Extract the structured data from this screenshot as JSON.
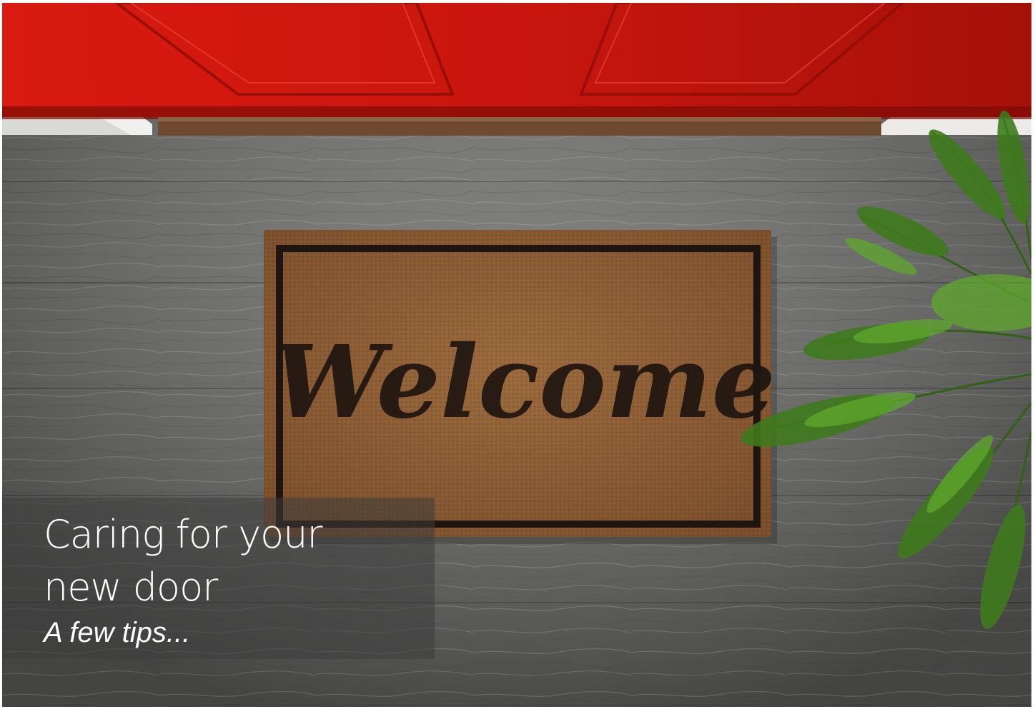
{
  "scene": {
    "mat_text": "Welcome",
    "colors": {
      "door": "#c9160e",
      "floor": "#6a6a68",
      "mat": "#8a5a34",
      "fern": "#3f7a1c"
    }
  },
  "caption": {
    "title": "Caring for your\nnew door",
    "subtitle": "A few tips..."
  }
}
